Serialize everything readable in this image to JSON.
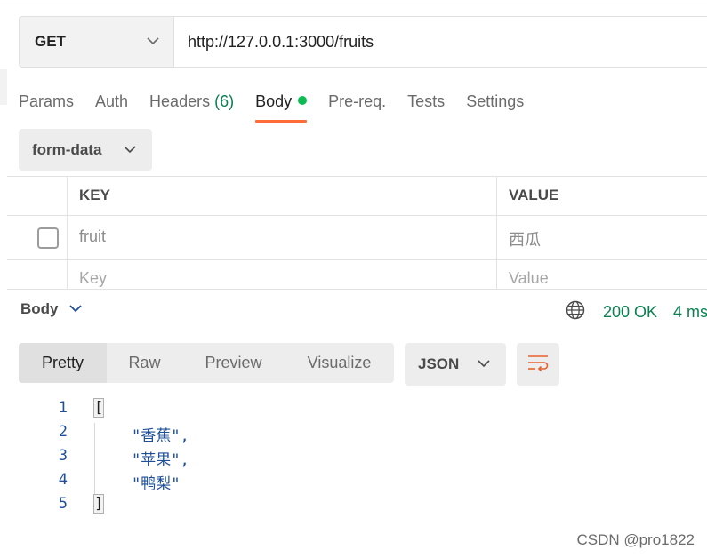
{
  "request": {
    "method": "GET",
    "url": "http://127.0.0.1:3000/fruits"
  },
  "tabs": {
    "params": "Params",
    "auth": "Auth",
    "headers": "Headers",
    "headers_count": "(6)",
    "body": "Body",
    "prereq": "Pre-req.",
    "tests": "Tests",
    "settings": "Settings"
  },
  "body_type": "form-data",
  "form_table": {
    "columns": {
      "key": "KEY",
      "value": "VALUE"
    },
    "rows": [
      {
        "key": "fruit",
        "value": "西瓜",
        "checked": false
      }
    ],
    "placeholder": {
      "key": "Key",
      "value": "Value"
    }
  },
  "response": {
    "section_label": "Body",
    "status": "200 OK",
    "time": "4 ms",
    "views": [
      "Pretty",
      "Raw",
      "Preview",
      "Visualize"
    ],
    "format": "JSON",
    "lines": [
      {
        "num": "1",
        "text": "["
      },
      {
        "num": "2",
        "text": "\"香蕉\","
      },
      {
        "num": "3",
        "text": "\"苹果\","
      },
      {
        "num": "4",
        "text": "\"鸭梨\""
      },
      {
        "num": "5",
        "text": "]"
      }
    ]
  },
  "watermark": "CSDN @pro1822",
  "colors": {
    "accent": "#ff6c37",
    "status_green": "#0b8050",
    "dot_green": "#0cbb52",
    "string_blue": "#1f4f99"
  },
  "icons": [
    "chevron-down-icon",
    "globe-icon",
    "wrap-lines-icon"
  ]
}
